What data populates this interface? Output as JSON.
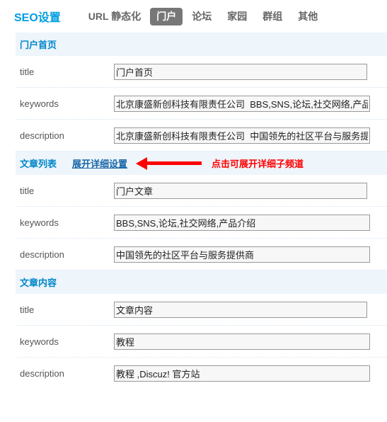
{
  "header": {
    "title": "SEO设置",
    "tabs": [
      {
        "label": "URL 静态化",
        "active": false
      },
      {
        "label": "门户",
        "active": true
      },
      {
        "label": "论坛",
        "active": false
      },
      {
        "label": "家园",
        "active": false
      },
      {
        "label": "群组",
        "active": false
      },
      {
        "label": "其他",
        "active": false
      }
    ]
  },
  "annotation": {
    "text": "点击可展开详细子频道",
    "color": "#fe0000"
  },
  "colors": {
    "brand_blue": "#009ee0",
    "section_text": "#0086cb",
    "section_bg": "#eef5fb",
    "link_blue": "#1966a8",
    "active_tab_bg": "#777777",
    "annotation_red": "#fe0000"
  },
  "sections": [
    {
      "name": "门户首页",
      "link": null,
      "has_annotation": false,
      "fields": [
        {
          "label": "title",
          "value": "门户首页",
          "wide": false
        },
        {
          "label": "keywords",
          "value": "北京康盛新创科技有限责任公司  BBS,SNS,论坛,社交网络,产品介绍",
          "wide": true
        },
        {
          "label": "description",
          "value": "北京康盛新创科技有限责任公司  中国领先的社区平台与服务提供商",
          "wide": true
        }
      ]
    },
    {
      "name": "文章列表",
      "link": "展开详细设置",
      "has_annotation": true,
      "fields": [
        {
          "label": "title",
          "value": "门户文章",
          "wide": false
        },
        {
          "label": "keywords",
          "value": "BBS,SNS,论坛,社交网络,产品介绍",
          "wide": true
        },
        {
          "label": "description",
          "value": "中国领先的社区平台与服务提供商",
          "wide": true
        }
      ]
    },
    {
      "name": "文章内容",
      "link": null,
      "has_annotation": false,
      "fields": [
        {
          "label": "title",
          "value": "文章内容",
          "wide": false
        },
        {
          "label": "keywords",
          "value": "教程",
          "wide": true
        },
        {
          "label": "description",
          "value": "教程 ,Discuz! 官方站",
          "wide": true
        }
      ]
    }
  ]
}
